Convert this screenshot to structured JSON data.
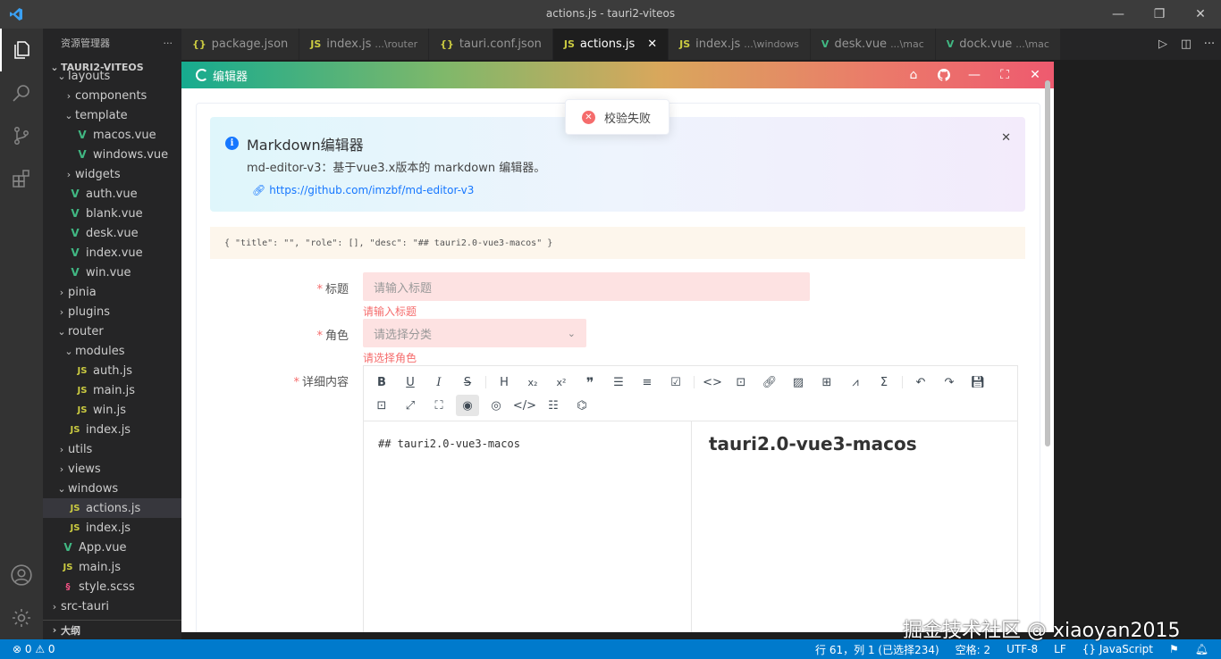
{
  "window": {
    "title": "actions.js - tauri2-viteos",
    "logo": "vscode-logo"
  },
  "sidebar": {
    "header": "资源管理器",
    "more": "···",
    "project": "TAURI2-VITEOS",
    "items": [
      {
        "label": "layouts",
        "type": "folder",
        "open": true,
        "depth": 2
      },
      {
        "label": "components",
        "type": "folder",
        "open": false,
        "depth": 3
      },
      {
        "label": "template",
        "type": "folder",
        "open": true,
        "depth": 3
      },
      {
        "label": "macos.vue",
        "type": "vue",
        "depth": 4
      },
      {
        "label": "windows.vue",
        "type": "vue",
        "depth": 4
      },
      {
        "label": "widgets",
        "type": "folder",
        "open": false,
        "depth": 3
      },
      {
        "label": "auth.vue",
        "type": "vue",
        "depth": 3
      },
      {
        "label": "blank.vue",
        "type": "vue",
        "depth": 3
      },
      {
        "label": "desk.vue",
        "type": "vue",
        "depth": 3
      },
      {
        "label": "index.vue",
        "type": "vue",
        "depth": 3
      },
      {
        "label": "win.vue",
        "type": "vue",
        "depth": 3
      },
      {
        "label": "pinia",
        "type": "folder",
        "open": false,
        "depth": 2
      },
      {
        "label": "plugins",
        "type": "folder",
        "open": false,
        "depth": 2
      },
      {
        "label": "router",
        "type": "folder",
        "open": true,
        "depth": 2
      },
      {
        "label": "modules",
        "type": "folder",
        "open": true,
        "depth": 3
      },
      {
        "label": "auth.js",
        "type": "js",
        "depth": 4
      },
      {
        "label": "main.js",
        "type": "js",
        "depth": 4
      },
      {
        "label": "win.js",
        "type": "js",
        "depth": 4
      },
      {
        "label": "index.js",
        "type": "js",
        "depth": 3
      },
      {
        "label": "utils",
        "type": "folder",
        "open": false,
        "depth": 2
      },
      {
        "label": "views",
        "type": "folder",
        "open": false,
        "depth": 2
      },
      {
        "label": "windows",
        "type": "folder",
        "open": true,
        "depth": 2
      },
      {
        "label": "actions.js",
        "type": "js",
        "depth": 3,
        "selected": true
      },
      {
        "label": "index.js",
        "type": "js",
        "depth": 3
      },
      {
        "label": "App.vue",
        "type": "vue",
        "depth": 2
      },
      {
        "label": "main.js",
        "type": "js",
        "depth": 2
      },
      {
        "label": "style.scss",
        "type": "scss",
        "depth": 2
      },
      {
        "label": "src-tauri",
        "type": "folder",
        "open": false,
        "depth": 1
      }
    ],
    "outline": "大纲"
  },
  "tabs": [
    {
      "label": "package.json",
      "icon": "{}",
      "desc": ""
    },
    {
      "label": "index.js",
      "icon": "JS",
      "desc": "...\\router"
    },
    {
      "label": "tauri.conf.json",
      "icon": "{}",
      "desc": ""
    },
    {
      "label": "actions.js",
      "icon": "JS",
      "desc": "",
      "active": true
    },
    {
      "label": "index.js",
      "icon": "JS",
      "desc": "...\\windows"
    },
    {
      "label": "desk.vue",
      "icon": "V",
      "desc": "...\\mac"
    },
    {
      "label": "dock.vue",
      "icon": "V",
      "desc": "...\\mac"
    }
  ],
  "app": {
    "title": "编辑器",
    "toast": "校验失败",
    "alert": {
      "title": "Markdown编辑器",
      "desc": "md-editor-v3：基于vue3.x版本的 markdown 编辑器。",
      "link": "https://github.com/imzbf/md-editor-v3"
    },
    "json_preview": "{ \"title\": \"\", \"role\": [], \"desc\": \"## tauri2.0-vue3-macos\" }",
    "form": {
      "title_label": "标题",
      "title_placeholder": "请输入标题",
      "title_error": "请输入标题",
      "role_label": "角色",
      "role_placeholder": "请选择分类",
      "role_error": "请选择角色",
      "content_label": "详细内容"
    },
    "editor": {
      "source": "## tauri2.0-vue3-macos",
      "preview_heading": "tauri2.0-vue3-macos"
    }
  },
  "status": {
    "errors": "0",
    "warnings": "0",
    "position": "行 61，列 1 (已选择234)",
    "spaces": "空格: 2",
    "encoding": "UTF-8",
    "eol": "LF",
    "language": "JavaScript"
  },
  "watermark": "掘金技术社区 @ xiaoyan2015"
}
